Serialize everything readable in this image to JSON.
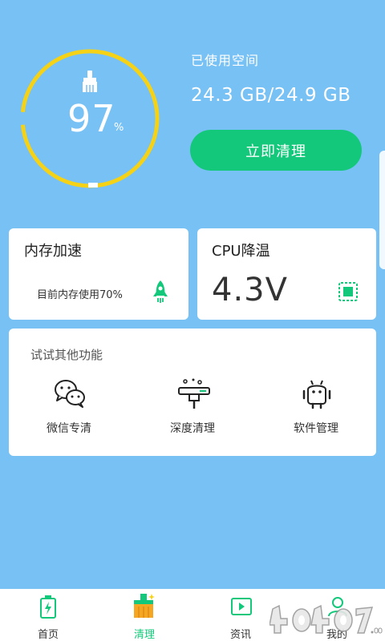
{
  "storage": {
    "percent": "97",
    "percent_unit": "%",
    "used_label": "已使用空间",
    "used_value": "24.3 GB/24.9 GB",
    "clean_button": "立即清理",
    "ring_color": "#f5d215"
  },
  "memory_card": {
    "title": "内存加速",
    "description": "目前内存使用70%",
    "icon": "rocket-icon"
  },
  "cpu_card": {
    "title": "CPU降温",
    "value": "4.3V",
    "icon": "chip-icon"
  },
  "features": {
    "title": "试试其他功能",
    "items": [
      {
        "label": "微信专清",
        "icon": "wechat-icon"
      },
      {
        "label": "深度清理",
        "icon": "deep-clean-icon"
      },
      {
        "label": "软件管理",
        "icon": "android-icon"
      }
    ]
  },
  "nav": {
    "items": [
      {
        "label": "首页",
        "icon": "battery-icon"
      },
      {
        "label": "清理",
        "icon": "broom-icon",
        "active": true
      },
      {
        "label": "资讯",
        "icon": "play-icon"
      },
      {
        "label": "我的",
        "icon": "user-icon"
      }
    ]
  },
  "colors": {
    "background": "#78c1f5",
    "accent_green": "#13c87a",
    "ring": "#f5d215"
  }
}
